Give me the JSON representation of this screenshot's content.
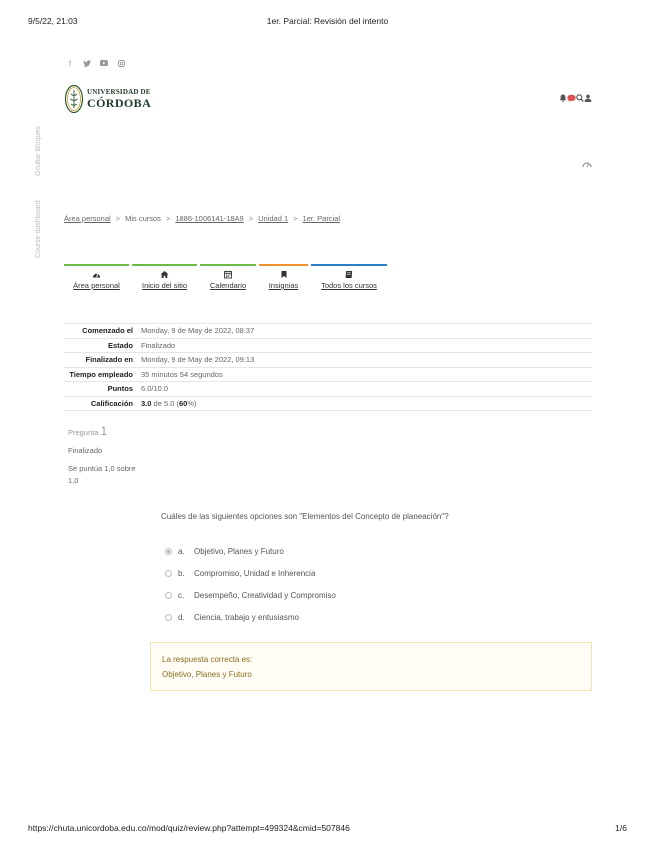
{
  "print": {
    "date": "9/5/22, 21:03",
    "title": "1er. Parcial: Revisión del intento",
    "url": "https://chuta.unicordoba.edu.co/mod/quiz/review.php?attempt=499324&cmid=507846",
    "page": "1/6"
  },
  "social": [
    {
      "icon": "facebook-icon",
      "glyph": "f"
    },
    {
      "icon": "twitter-icon",
      "glyph": "▾"
    },
    {
      "icon": "youtube-icon",
      "glyph": "▶"
    },
    {
      "icon": "instagram-icon",
      "glyph": "◎"
    }
  ],
  "logo": {
    "line1": "UNIVERSIDAD DE",
    "line2": "CÓRDOBA"
  },
  "side": {
    "hide_blocks": "Ocultar Bloques",
    "course_dashboard": "Course dashboard"
  },
  "breadcrumb": {
    "items": [
      "Área personal",
      "Mis cursos",
      "1886-1006141-18A9",
      "Unidad 1",
      "1er. Parcial"
    ],
    "sep": ">"
  },
  "nav": [
    {
      "label": "Área personal",
      "color": "#6cba45"
    },
    {
      "label": "Inicio del sitio",
      "color": "#6cba45"
    },
    {
      "label": "Calendario",
      "color": "#6cba45"
    },
    {
      "label": "Insignias",
      "color": "#f0922b"
    },
    {
      "label": "Todos los cursos",
      "color": "#2f7ec4"
    }
  ],
  "summary": {
    "started_label": "Comenzado el",
    "started": "Monday, 9 de May de 2022, 08:37",
    "state_label": "Estado",
    "state": "Finalizado",
    "finished_label": "Finalizado en",
    "finished": "Monday, 9 de May de 2022, 09:13",
    "time_label": "Tiempo empleado",
    "time": "35 minutos 54 segundos",
    "points_label": "Puntos",
    "points": "6.0/10.0",
    "grade_label": "Calificación",
    "grade_value": "3.0",
    "grade_rest": " de 5.0 (",
    "grade_pct": "60",
    "grade_end": "%)"
  },
  "question": {
    "label": "Pregunta",
    "number": "1",
    "state": "Finalizado",
    "grade": "Se puntúa 1,0 sobre 1,0",
    "text": "Cuáles de las siguientes opciones son \"Elementos del Concepto de planeación\"?",
    "answers": [
      {
        "letter": "a.",
        "text": "Objetivo, Planes y Futuro",
        "checked": true
      },
      {
        "letter": "b.",
        "text": "Compromiso, Unidad e Inherencia",
        "checked": false
      },
      {
        "letter": "c.",
        "text": "Desempeño, Creatividad y Compromiso",
        "checked": false
      },
      {
        "letter": "d.",
        "text": "Ciencia, trabajo y entusiasmo",
        "checked": false
      }
    ],
    "feedback_label": "La respuesta correcta es:",
    "feedback_answer": "Objetivo, Planes y Futuro"
  },
  "colors": {
    "accent_green": "#6cba45",
    "accent_orange": "#f0922b",
    "accent_blue": "#2f7ec4",
    "brand_dark": "#1d3b25",
    "notify_red": "#d9534f"
  }
}
